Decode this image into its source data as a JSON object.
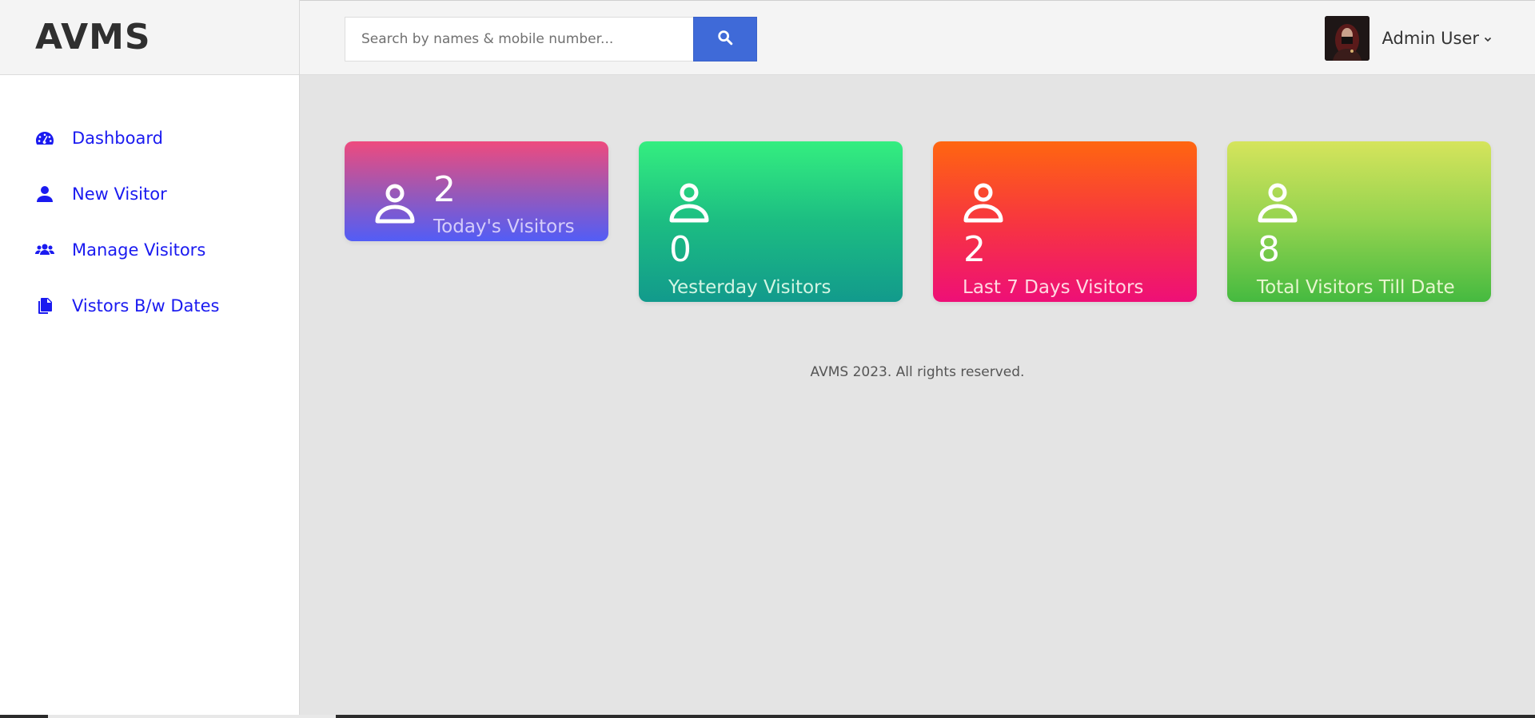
{
  "brand": {
    "name": "AVMS"
  },
  "sidebar": {
    "items": [
      {
        "label": "Dashboard",
        "icon": "dashboard-icon"
      },
      {
        "label": "New Visitor",
        "icon": "user-icon"
      },
      {
        "label": "Manage Visitors",
        "icon": "users-icon"
      },
      {
        "label": "Vistors B/w Dates",
        "icon": "copy-icon"
      }
    ]
  },
  "header": {
    "search": {
      "placeholder": "Search by names & mobile number...",
      "value": ""
    },
    "search_icon": "search-icon",
    "user": {
      "name": "Admin User",
      "icon": "chevron-down-icon"
    }
  },
  "cards": [
    {
      "value": "2",
      "label": "Today's Visitors",
      "icon": "person-icon"
    },
    {
      "value": "0",
      "label": "Yesterday Visitors",
      "icon": "person-icon"
    },
    {
      "value": "2",
      "label": "Last 7 Days Visitors",
      "icon": "person-icon"
    },
    {
      "value": "8",
      "label": "Total Visitors Till Date",
      "icon": "person-icon"
    }
  ],
  "footer": {
    "text": "AVMS 2023. All rights reserved."
  },
  "colors": {
    "accent": "#3f6ad8",
    "nav_link": "#1a1af0",
    "card_today": [
      "#ee4a7e",
      "#525df6"
    ],
    "card_yesterday": [
      "#34ee80",
      "#129a8c"
    ],
    "card_week": [
      "#ff6610",
      "#ee0f77"
    ],
    "card_total": [
      "#d5e45c",
      "#45ba40"
    ]
  }
}
